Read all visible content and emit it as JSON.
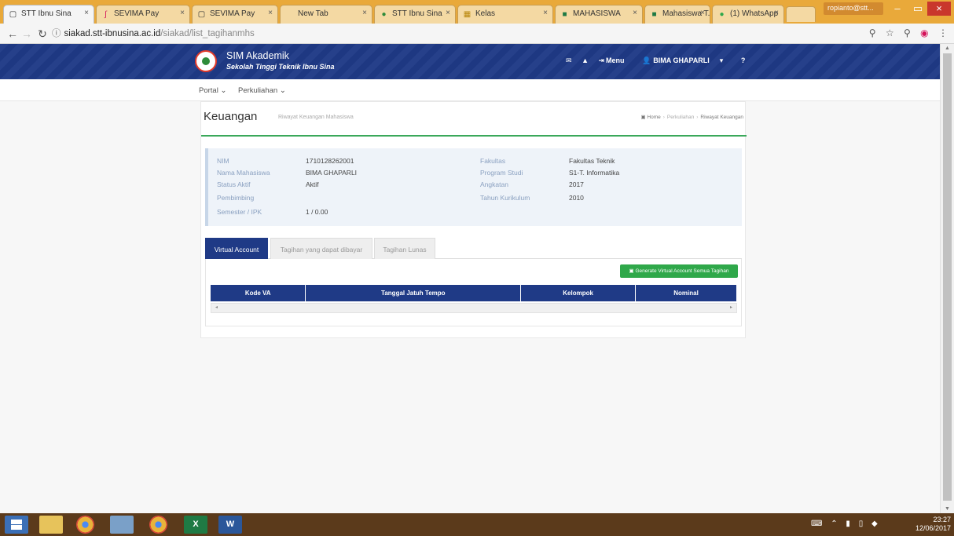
{
  "browser": {
    "tabs": [
      {
        "label": "STT Ibnu Sina",
        "icon": "page",
        "active": true
      },
      {
        "label": "SEVIMA Pay",
        "icon": "sevima"
      },
      {
        "label": "SEVIMA Pay",
        "icon": "page"
      },
      {
        "label": "New Tab",
        "icon": "none"
      },
      {
        "label": "STT Ibnu Sina",
        "icon": "logo"
      },
      {
        "label": "Kelas",
        "icon": "grid"
      },
      {
        "label": "MAHASISWA",
        "icon": "app"
      },
      {
        "label": "Mahasiswa T.I",
        "icon": "app"
      },
      {
        "label": "(1) WhatsApp",
        "icon": "whatsapp"
      }
    ],
    "profile_label": "ropianto@stt...",
    "url_host": "siakad.stt-ibnusina.ac.id",
    "url_path": "/siakad/list_tagihanmhs"
  },
  "site": {
    "title": "SIM Akademik",
    "subtitle": "Sekolah Tinggi Teknik Ibnu Sina",
    "menu_label": "Menu",
    "user_label": "BIMA GHAPARLI",
    "nav": [
      "Portal",
      "Perkuliahan"
    ]
  },
  "page": {
    "title": "Keuangan",
    "subtitle": "Riwayat Keuangan Mahasiswa",
    "breadcrumb": [
      "Home",
      "Perkuliahan",
      "Riwayat Keuangan"
    ]
  },
  "student": {
    "left": [
      {
        "label": "NIM",
        "value": "1710128262001"
      },
      {
        "label": "Nama Mahasiswa",
        "value": "BIMA GHAPARLI"
      },
      {
        "label": "Status Aktif",
        "value": "Aktif"
      },
      {
        "label": "Pembimbing",
        "value": ""
      },
      {
        "label": "Semester / IPK",
        "value": "1 / 0.00"
      }
    ],
    "right": [
      {
        "label": "Fakultas",
        "value": "Fakultas Teknik"
      },
      {
        "label": "Program Studi",
        "value": "S1-T. Informatika"
      },
      {
        "label": "Angkatan",
        "value": "2017"
      },
      {
        "label": "Tahun Kurikulum",
        "value": "2010"
      }
    ]
  },
  "tabs": [
    "Virtual Account",
    "Tagihan yang dapat dibayar",
    "Tagihan Lunas"
  ],
  "generate_button": "Generate Virtual Account Semua Tagihan",
  "table": {
    "columns": [
      "Kode VA",
      "Tanggal Jatuh Tempo",
      "Kelompok",
      "Nominal"
    ]
  },
  "taskbar": {
    "time": "23:27",
    "date": "12/06/2017"
  },
  "colors": {
    "header_blue": "#1f3a86",
    "accent_green": "#2fa84a"
  }
}
